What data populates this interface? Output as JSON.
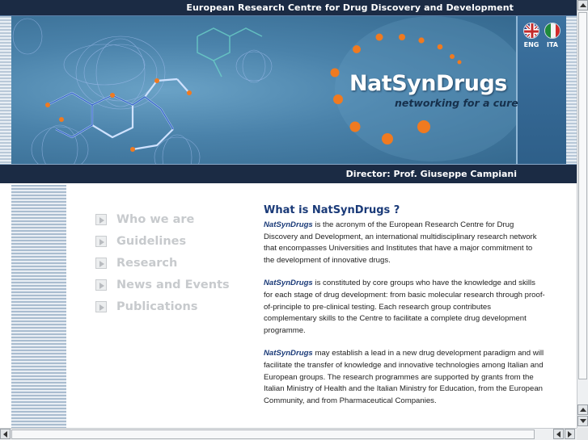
{
  "header": {
    "title": "European Research Centre for Drug Discovery and Development",
    "director": "Director: Prof. Giuseppe Campiani"
  },
  "brand": {
    "name": "NatSynDrugs",
    "tagline": "networking for a cure"
  },
  "languages": [
    {
      "label": "ENG",
      "icon": "uk-flag-icon"
    },
    {
      "label": "ITA",
      "icon": "italy-flag-icon"
    }
  ],
  "nav": {
    "items": [
      {
        "label": "Who we are"
      },
      {
        "label": "Guidelines"
      },
      {
        "label": "Research"
      },
      {
        "label": "News and Events"
      },
      {
        "label": "Publications"
      }
    ]
  },
  "content": {
    "title": "What is NatSynDrugs ?",
    "paragraphs": [
      {
        "em": "NatSynDrugs",
        "text": " is the acronym of the European Research Centre for Drug Discovery and Development, an international multidisciplinary research network that encompasses Universities and Institutes that have a major commitment to the development of innovative drugs."
      },
      {
        "em": "NatSynDrugs",
        "text": " is constituted by core groups who have the knowledge and skills for each stage of drug development: from basic molecular research through proof-of-principle to pre-clinical testing. Each research group contributes complementary skills to the Centre to facilitate a complete drug development programme."
      },
      {
        "em": "NatSynDrugs",
        "text": " may establish a lead in a new drug development paradigm and will facilitate the transfer of knowledge and innovative technologies among Italian and European groups. The research programmes are supported by grants from the Italian Ministry of Health and the Italian Ministry for Education, from the European Community, and from Pharmaceutical Companies."
      }
    ]
  },
  "colors": {
    "header_bg": "#1b2b44",
    "title_blue": "#1a3a78",
    "accent_orange": "#f07a20",
    "nav_gray": "#c7cacd"
  }
}
